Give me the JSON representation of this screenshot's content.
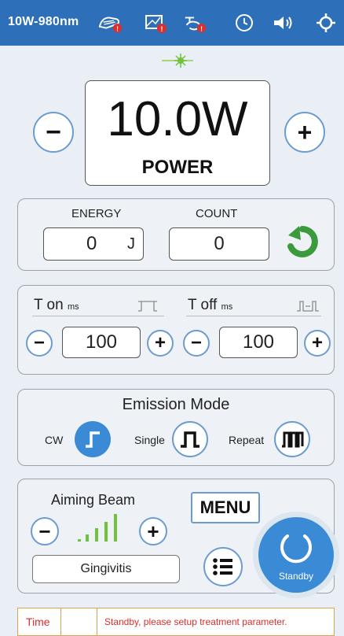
{
  "header": {
    "model": "10W-980nm",
    "icons": [
      "footswitch-alert-icon",
      "fiber-alert-icon",
      "interlock-alert-icon",
      "clock-icon",
      "speaker-icon",
      "settings-icon"
    ]
  },
  "power": {
    "value": "10.0W",
    "label": "POWER",
    "minus": "−",
    "plus": "+"
  },
  "energy": {
    "label": "ENERGY",
    "value": "0",
    "unit": "J"
  },
  "count": {
    "label": "COUNT",
    "value": "0"
  },
  "timing": {
    "ton_label": "T on",
    "ton_unit": "ms",
    "ton_value": "100",
    "toff_label": "T off",
    "toff_unit": "ms",
    "toff_value": "100",
    "minus": "−",
    "plus": "+"
  },
  "emission": {
    "title": "Emission Mode",
    "modes": [
      "CW",
      "Single",
      "Repeat"
    ],
    "selected": "CW"
  },
  "aiming": {
    "title": "Aiming Beam",
    "minus": "−",
    "plus": "+",
    "level": 5,
    "max_level": 5
  },
  "menu_label": "MENU",
  "procedure": "Gingivitis",
  "standby_label": "Standby",
  "status": {
    "time_label": "Time",
    "time_value": "",
    "message": "Standby, please setup treatment parameter."
  },
  "colors": {
    "header": "#2d6fb8",
    "accent": "#3a8ad6",
    "alert": "#d9302f",
    "ok": "#3b9a3b",
    "bar": "#6fc23a"
  }
}
